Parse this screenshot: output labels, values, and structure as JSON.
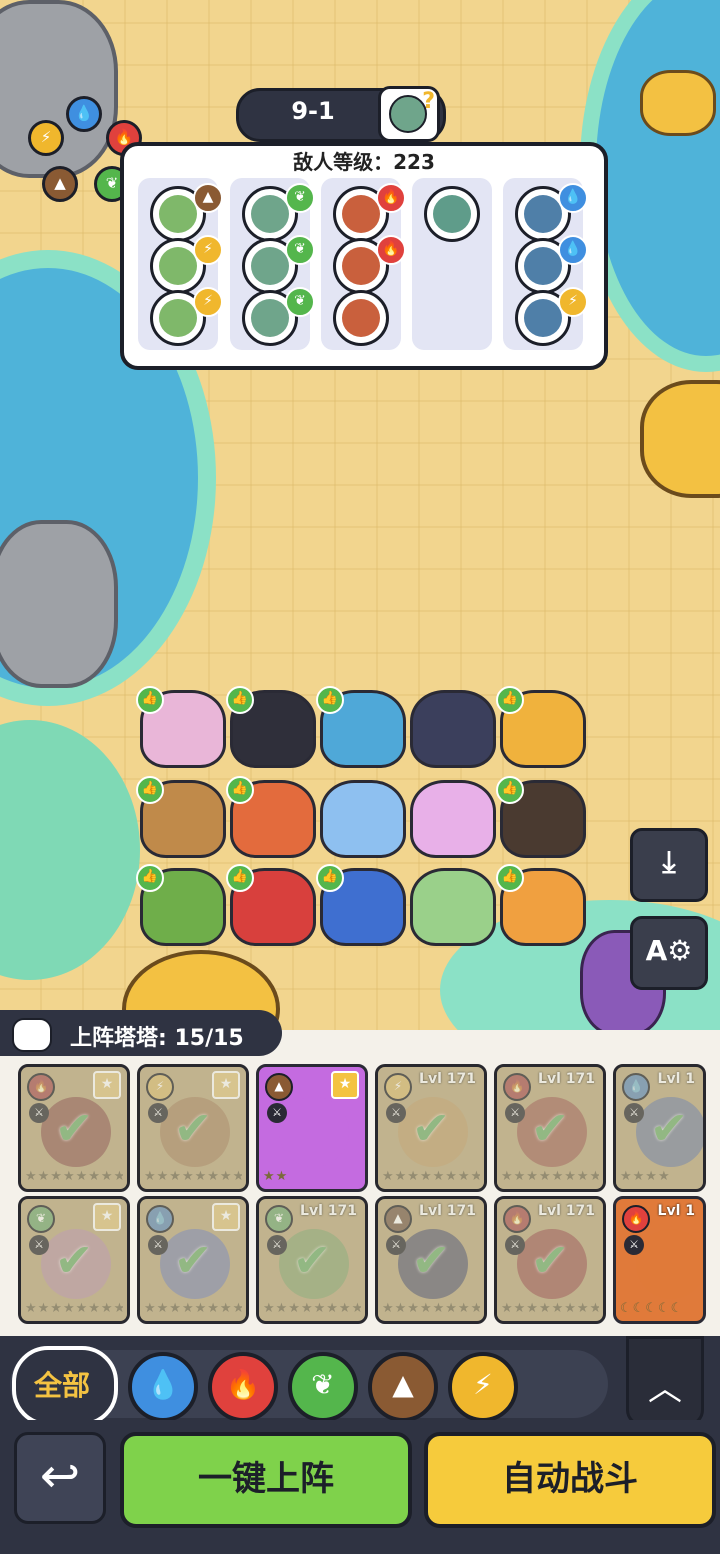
{
  "stage": {
    "label": "9-1",
    "icon": "zombie-question-icon"
  },
  "enemy_panel": {
    "level_text": "敌人等级：223",
    "columns": [
      {
        "enemies": [
          {
            "element": "earth"
          },
          {
            "element": "lightning"
          },
          {
            "element": "lightning"
          }
        ]
      },
      {
        "enemies": [
          {
            "element": "leaf"
          },
          {
            "element": "leaf"
          },
          {
            "element": "leaf"
          }
        ]
      },
      {
        "enemies": [
          {
            "element": "fire"
          },
          {
            "element": "fire"
          },
          {
            "element": ""
          }
        ]
      },
      {
        "enemies": [
          {
            "element": ""
          }
        ]
      },
      {
        "enemies": [
          {
            "element": "water"
          },
          {
            "element": "water"
          },
          {
            "element": "lightning"
          }
        ]
      }
    ]
  },
  "element_colors": {
    "water": "#3f8fe0",
    "fire": "#e0413d",
    "leaf": "#54b64c",
    "earth": "#8a5a33",
    "lightning": "#f0b72d"
  },
  "element_icons": {
    "water": "💧",
    "fire": "🔥",
    "leaf": "❦",
    "earth": "▲",
    "lightning": "⚡"
  },
  "side_buttons": {
    "download_icon": "⤓",
    "auto_settings_label": "A⚙"
  },
  "roster": {
    "title": "上阵塔塔: 15/15",
    "cards": [
      {
        "element": "fire",
        "level": "",
        "selected": true,
        "star_badge": true,
        "color": "#b0453a",
        "stars": "★★★★★★★★"
      },
      {
        "element": "lightning",
        "level": "",
        "selected": true,
        "star_badge": true,
        "color": "#c07a3a",
        "stars": "★★★★★★★★"
      },
      {
        "element": "earth",
        "level": "",
        "selected": false,
        "star_badge": true,
        "color": "#c46be0",
        "stars": "★★"
      },
      {
        "element": "lightning",
        "level": "Lvl 171",
        "selected": true,
        "star_badge": false,
        "color": "#d89a3a",
        "stars": "★★★★★★★★"
      },
      {
        "element": "fire",
        "level": "Lvl 171",
        "selected": true,
        "star_badge": false,
        "color": "#c9503d",
        "stars": "★★★★★★★★"
      },
      {
        "element": "water",
        "level": "Lvl 1",
        "selected": true,
        "star_badge": false,
        "color": "#5c7bbf",
        "stars": "★★★★"
      },
      {
        "element": "leaf",
        "level": "",
        "selected": true,
        "star_badge": true,
        "color": "#d08ab0",
        "stars": "★★★★★★★★"
      },
      {
        "element": "water",
        "level": "",
        "selected": true,
        "star_badge": true,
        "color": "#6a7fd8",
        "stars": "★★★★★★★★"
      },
      {
        "element": "leaf",
        "level": "Lvl 171",
        "selected": true,
        "star_badge": false,
        "color": "#6fae4a",
        "stars": "★★★★★★★★"
      },
      {
        "element": "earth",
        "level": "Lvl 171",
        "selected": true,
        "star_badge": false,
        "color": "#4a5080",
        "stars": "★★★★★★★★"
      },
      {
        "element": "fire",
        "level": "Lvl 171",
        "selected": true,
        "star_badge": false,
        "color": "#c9403d",
        "stars": "★★★★★★★★"
      },
      {
        "element": "fire",
        "level": "Lvl 1",
        "selected": false,
        "star_badge": false,
        "color": "#e07a3a",
        "stars": "☾☾☾☾☾"
      }
    ]
  },
  "filters": {
    "all_label": "全部",
    "items": [
      "water",
      "fire",
      "leaf",
      "earth",
      "lightning"
    ]
  },
  "buttons": {
    "back_icon": "↩",
    "deploy_label": "一键上阵",
    "auto_battle_label": "自动战斗",
    "collapse_icon": "︿"
  }
}
